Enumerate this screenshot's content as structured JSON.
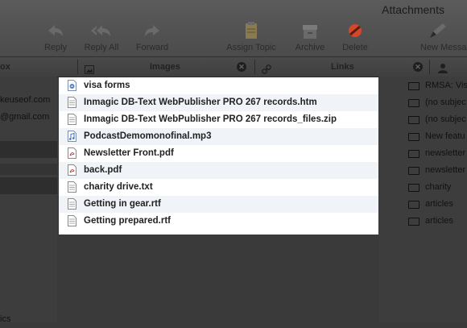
{
  "window": {
    "title": "Attachments"
  },
  "toolbar": {
    "buttons": [
      {
        "label": "Reply",
        "icon": "reply-icon"
      },
      {
        "label": "Reply All",
        "icon": "reply-all-icon"
      },
      {
        "label": "Forward",
        "icon": "forward-icon"
      },
      {
        "label": "Assign Topic",
        "icon": "assign-topic-icon"
      },
      {
        "label": "Archive",
        "icon": "archive-icon"
      },
      {
        "label": "Delete",
        "icon": "delete-icon"
      },
      {
        "label": "New Messa",
        "icon": "new-message-icon"
      }
    ]
  },
  "tabs": [
    {
      "label": "ox"
    },
    {
      "label": "Images",
      "icon": "image-icon"
    },
    {
      "label": "Links",
      "icon": "link-icon"
    },
    {
      "label": "",
      "icon": "person-icon"
    }
  ],
  "left_list": [
    {
      "text": "keuseof.com"
    },
    {
      "text": "@gmail.com"
    },
    {
      "text": ""
    },
    {
      "text": ""
    },
    {
      "text": ""
    },
    {
      "text": "ics"
    }
  ],
  "attachments": [
    {
      "name": "visa forms",
      "icon": "link-file-icon"
    },
    {
      "name": "Inmagic DB-Text WebPublisher PRO 267 records.htm",
      "icon": "document-icon"
    },
    {
      "name": "Inmagic DB-Text WebPublisher PRO 267 records_files.zip",
      "icon": "document-icon"
    },
    {
      "name": "PodcastDemomonofinal.mp3",
      "icon": "audio-file-icon"
    },
    {
      "name": "Newsletter Front.pdf",
      "icon": "pdf-file-icon"
    },
    {
      "name": "back.pdf",
      "icon": "pdf-file-icon"
    },
    {
      "name": "charity drive.txt",
      "icon": "document-icon"
    },
    {
      "name": "Getting in gear.rtf",
      "icon": "document-icon"
    },
    {
      "name": "Getting prepared.rtf",
      "icon": "document-icon"
    }
  ],
  "subjects": [
    "RMSA: Vis",
    "(no subjec",
    "(no subjec",
    "New featu",
    "newsletter",
    "newsletter",
    "charity",
    "articles",
    "articles"
  ],
  "colors": {
    "background": "#3a3a3a",
    "popup": "#ffffff",
    "alt_row": "#f0f3f8",
    "selected_row": "#2f2f2f",
    "delete": "#d4472a"
  }
}
